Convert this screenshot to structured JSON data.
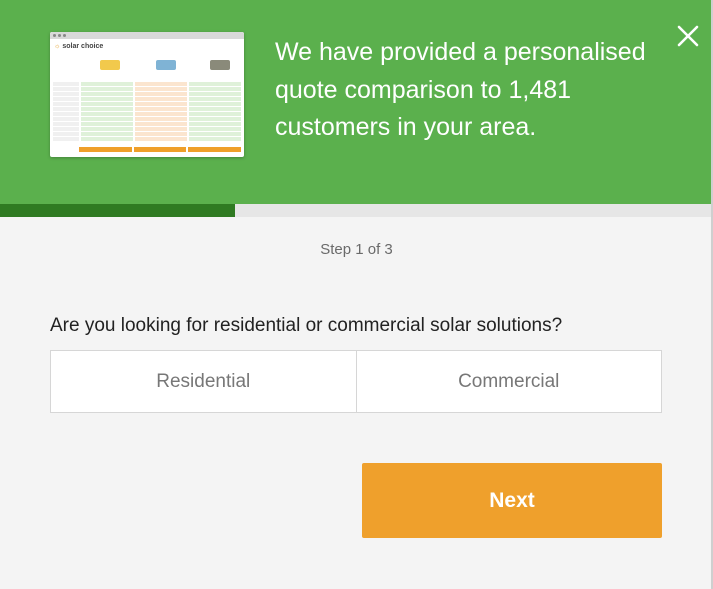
{
  "header": {
    "headline": "We have provided a personalised quote comparison to 1,481 customers in your area.",
    "thumbnail": {
      "brand_text": "solar choice",
      "icon": "quote-comparison-preview"
    },
    "close_icon": "close-icon"
  },
  "progress": {
    "fraction": 0.33,
    "step_text": "Step 1 of 3"
  },
  "form": {
    "question": "Are you looking for residential or commercial solar solutions?",
    "options": [
      {
        "label": "Residential"
      },
      {
        "label": "Commercial"
      }
    ],
    "next_label": "Next"
  },
  "colors": {
    "header_bg": "#5bb04d",
    "progress_fill": "#2f7a22",
    "button": "#efa02c"
  }
}
